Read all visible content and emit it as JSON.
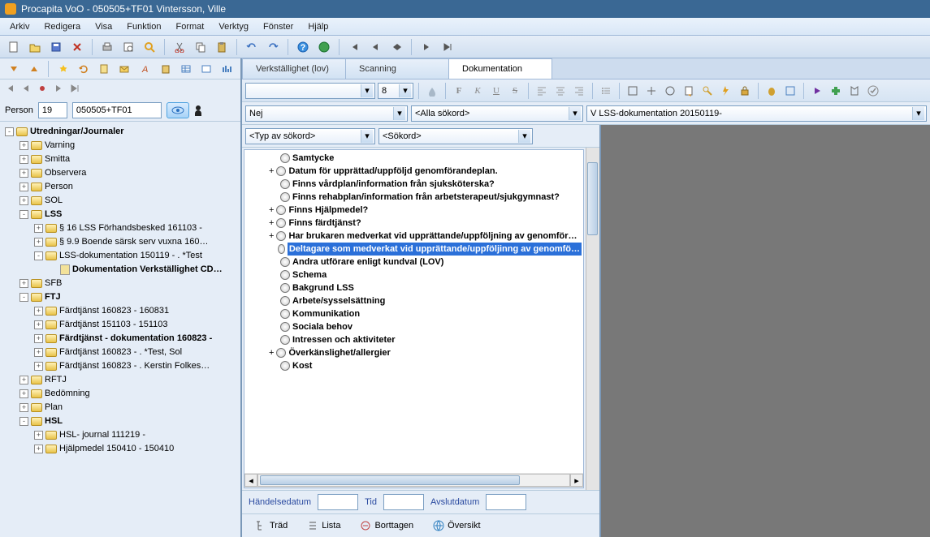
{
  "window": {
    "title": "Procapita VoO - 050505+TF01 Vintersson, Ville"
  },
  "menubar": [
    "Arkiv",
    "Redigera",
    "Visa",
    "Funktion",
    "Format",
    "Verktyg",
    "Fönster",
    "Hjälp"
  ],
  "person": {
    "label": "Person",
    "num": "19",
    "code": "050505+TF01"
  },
  "leftTree": [
    {
      "exp": "-",
      "bold": true,
      "label": "Utredningar/Journaler",
      "children": [
        {
          "exp": "+",
          "label": "Varning"
        },
        {
          "exp": "+",
          "label": "Smitta"
        },
        {
          "exp": "+",
          "label": "Observera"
        },
        {
          "exp": "+",
          "label": "Person"
        },
        {
          "exp": "+",
          "label": "SOL"
        },
        {
          "exp": "-",
          "bold": true,
          "label": "LSS",
          "children": [
            {
              "exp": "+",
              "label": "§ 16 LSS Förhandsbesked 161103 -"
            },
            {
              "exp": "+",
              "label": "§ 9.9 Boende särsk serv vuxna 160…"
            },
            {
              "exp": "-",
              "label": "LSS-dokumentation 150119 - . *Test",
              "children": [
                {
                  "label": "Dokumentation Verkställighet CD…",
                  "bold": true
                }
              ]
            }
          ]
        },
        {
          "exp": "+",
          "label": "SFB"
        },
        {
          "exp": "-",
          "bold": true,
          "label": "FTJ",
          "children": [
            {
              "exp": "+",
              "label": "Färdtjänst 160823 - 160831"
            },
            {
              "exp": "+",
              "label": "Färdtjänst 151103 - 151103"
            },
            {
              "exp": "+",
              "bold": true,
              "label": "Färdtjänst - dokumentation 160823 -"
            },
            {
              "exp": "+",
              "label": "Färdtjänst 160823 - . *Test, Sol"
            },
            {
              "exp": "+",
              "label": "Färdtjänst 160823 - . Kerstin Folkes…"
            }
          ]
        },
        {
          "exp": "+",
          "label": "RFTJ"
        },
        {
          "exp": "+",
          "label": "Bedömning"
        },
        {
          "exp": "+",
          "label": "Plan"
        },
        {
          "exp": "-",
          "bold": true,
          "label": "HSL",
          "children": [
            {
              "exp": "+",
              "label": "HSL- journal 111219 -"
            },
            {
              "exp": "+",
              "label": "Hjälpmedel 150410 - 150410"
            }
          ]
        }
      ]
    }
  ],
  "tabs": [
    {
      "label": "Verkställighet (lov)",
      "active": false
    },
    {
      "label": "Scanning",
      "active": false
    },
    {
      "label": "Dokumentation",
      "active": true
    }
  ],
  "formatbar": {
    "font": "",
    "size": "8"
  },
  "selectors": {
    "nej": "Nej",
    "alla": "<Alla sökord>",
    "doc": "V LSS-dokumentation 20150119-"
  },
  "kwRow": {
    "typ": "<Typ av sökord>",
    "sok": "<Sökord>"
  },
  "docTree": [
    {
      "label": "Samtycke",
      "bold": true
    },
    {
      "exp": "+",
      "label": "Datum för upprättad/uppföljd genomförandeplan.",
      "bold": true
    },
    {
      "label": "Finns vårdplan/information från sjuksköterska?",
      "bold": true
    },
    {
      "label": "Finns rehabplan/information från arbetsterapeut/sjukgymnast?",
      "bold": true
    },
    {
      "exp": "+",
      "label": "Finns Hjälpmedel?",
      "bold": true
    },
    {
      "exp": "+",
      "label": "Finns färdtjänst?",
      "bold": true
    },
    {
      "exp": "+",
      "label": "Har brukaren medverkat vid upprättande/uppföljning av genomför…",
      "bold": true
    },
    {
      "label": "Deltagare som medverkat vid upprättande/uppföljinng av genomfö…",
      "bold": true,
      "selected": true
    },
    {
      "label": "Andra utförare enligt kundval (LOV)",
      "bold": true
    },
    {
      "label": "Schema",
      "bold": true
    },
    {
      "label": "Bakgrund LSS",
      "bold": true
    },
    {
      "label": "Arbete/sysselsättning",
      "bold": true
    },
    {
      "label": "Kommunikation",
      "bold": true
    },
    {
      "label": "Sociala behov",
      "bold": true
    },
    {
      "label": "Intressen och aktiviteter",
      "bold": true
    },
    {
      "exp": "+",
      "label": "Överkänslighet/allergier",
      "bold": true
    },
    {
      "label": "Kost",
      "bold": true
    }
  ],
  "dateRow": {
    "handLabel": "Händelsedatum",
    "tidLabel": "Tid",
    "avslutLabel": "Avslutdatum"
  },
  "bottomTabs": [
    "Träd",
    "Lista",
    "Borttagen",
    "Översikt"
  ]
}
